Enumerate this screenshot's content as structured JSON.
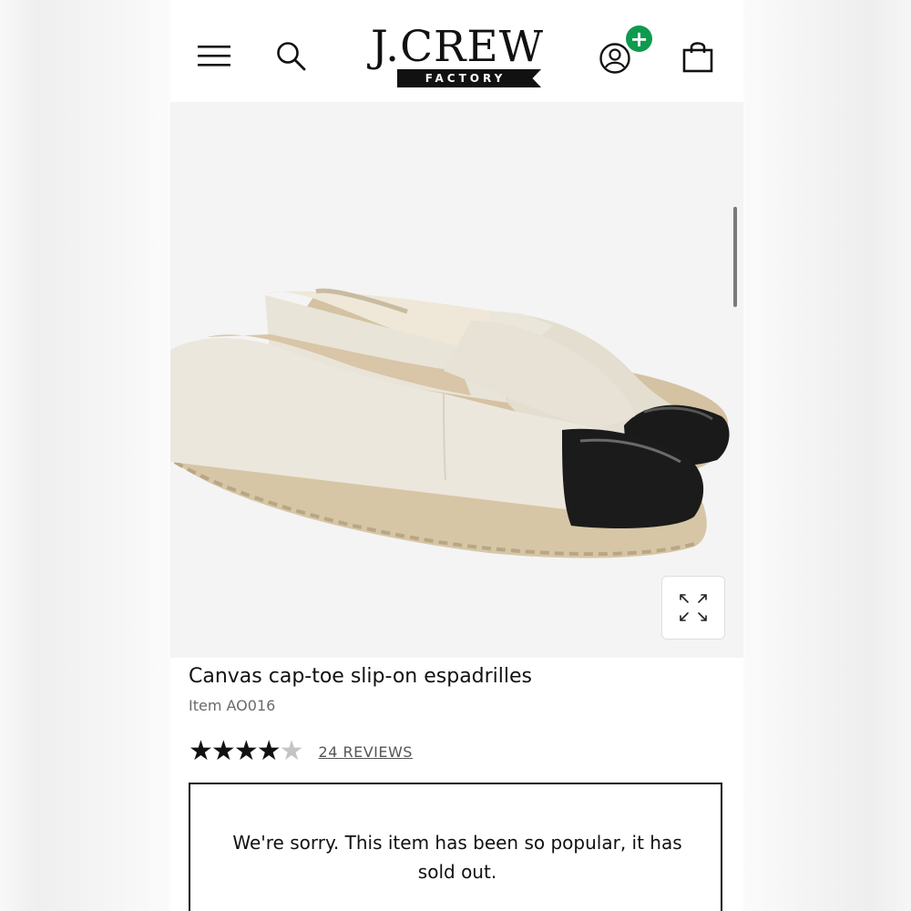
{
  "header": {
    "logo_main": "J.CREW",
    "logo_sub": "FACTORY",
    "account_badge": "+",
    "badge_color": "#0e9a4f",
    "icons": [
      "menu-icon",
      "search-icon",
      "account-icon",
      "bag-icon"
    ]
  },
  "product": {
    "title": "Canvas cap-toe slip-on espadrilles",
    "item_number": "Item AO016",
    "rating": {
      "stars_filled": 4,
      "stars_total": 5,
      "full_star": "★",
      "empty_star": "★",
      "reviews_label": "24 REVIEWS"
    },
    "image_icons": [
      "espadrille-image",
      "expand-icon"
    ]
  },
  "availability": {
    "message": "We're sorry. This item has been so popular, it has sold out."
  }
}
